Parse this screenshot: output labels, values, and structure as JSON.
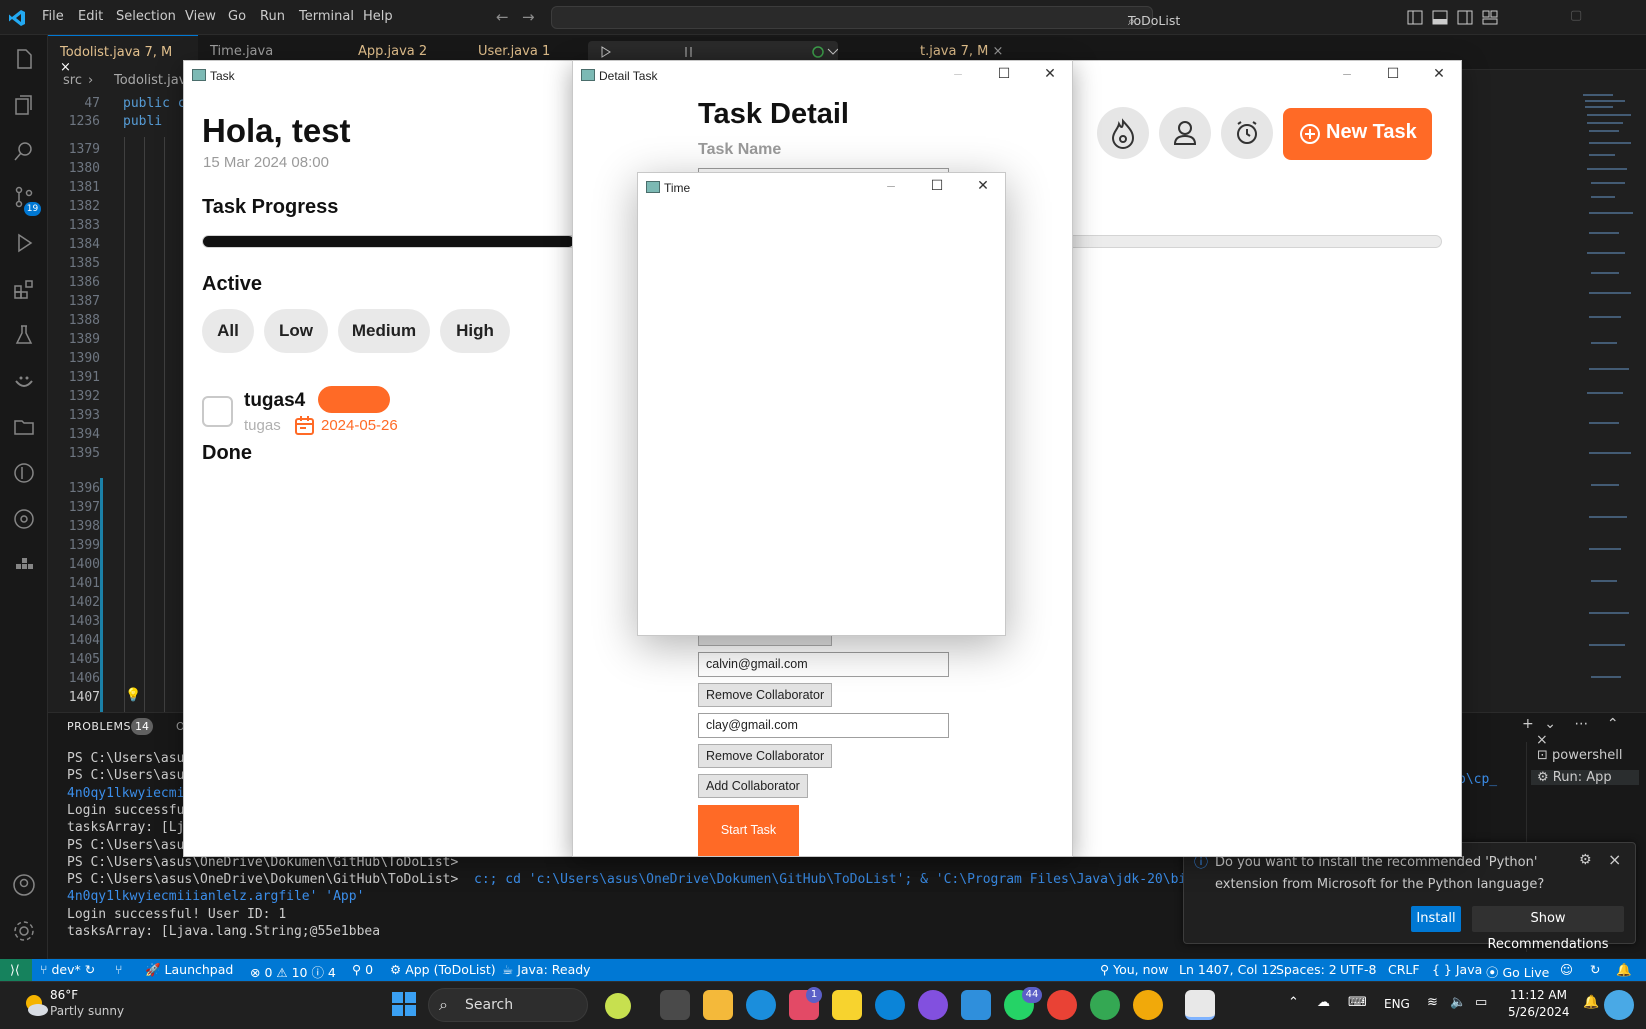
{
  "vscode": {
    "menu": [
      "File",
      "Edit",
      "Selection",
      "View",
      "Go",
      "Run",
      "Terminal",
      "Help"
    ],
    "search_label": "ToDoList",
    "tabs": [
      {
        "label": "Todolist.java",
        "badge": "7, M"
      },
      {
        "label": "Time.java",
        "badge": ""
      },
      {
        "label": "App.java",
        "badge": "2"
      },
      {
        "label": "User.java",
        "badge": "1"
      },
      {
        "label": "t.java",
        "badge": "7, M"
      }
    ],
    "breadcrumb": [
      "src",
      "Todolist.java"
    ],
    "code": {
      "sticky": [
        {
          "num": "47",
          "text": "public c"
        },
        {
          "num": "1236",
          "text": "  publi"
        }
      ],
      "line_numbers": [
        "1379",
        "1380",
        "1381",
        "1382",
        "1383",
        "1384",
        "1385",
        "1386",
        "1387",
        "1388",
        "1389",
        "1390",
        "1391",
        "1392",
        "1393",
        "1394",
        "1395",
        "1396",
        "1397",
        "1398",
        "1399",
        "1400",
        "1401",
        "1402",
        "1403",
        "1404",
        "1405",
        "1406",
        "1407"
      ]
    },
    "panel": {
      "title": "PROBLEMS",
      "problems_count": "14",
      "tab2_stub": "O",
      "terminal_lines": [
        {
          "ps": "PS C:\\Users\\asus",
          "rest": ""
        },
        {
          "ps": "PS C:\\Users\\asus",
          "rest": ""
        },
        {
          "ps": "",
          "rest": "4n0qy1lkwyiecmi"
        },
        {
          "ps": "",
          "rest": "Login successful"
        },
        {
          "ps": "",
          "rest": "tasksArray: [Lja"
        },
        {
          "ps": "PS C:\\Users\\asus",
          "rest": ""
        },
        {
          "ps": "PS C:\\Users\\asus\\OneDrive\\Dokumen\\GitHub\\ToDoList>",
          "rest": ""
        },
        {
          "ps": "PS C:\\Users\\asus\\OneDrive\\Dokumen\\GitHub\\ToDoList>",
          "rest": "  c:; cd 'c:\\Users\\asus\\OneDrive\\Dokumen\\GitHub\\ToDoList'; & 'C:\\Program Files\\Java\\jdk-20\\bin\\java.e"
        },
        {
          "ps": "",
          "rest": "4n0qy1lkwyiecmiiianlelz.argfile' 'App'"
        },
        {
          "ps": "",
          "rest": "Login successful! User ID: 1"
        },
        {
          "ps": "",
          "rest": "tasksArray: [Ljava.lang.String;@55e1bbea"
        }
      ],
      "right_stub": "p\\cp_",
      "terminals": [
        "powershell",
        "Run: App"
      ]
    },
    "notification": {
      "text": "Do you want to install the recommended 'Python' extension from Microsoft for the Python language?",
      "install": "Install",
      "show": "Show Recommendations"
    },
    "status": {
      "branch": "dev*",
      "launchpad": "Launchpad",
      "errors": "0",
      "warnings": "10",
      "infos": "4",
      "ports": "0",
      "app": "App (ToDoList)",
      "java": "Java: Ready",
      "blame": "You, now",
      "position": "Ln 1407, Col 12",
      "spaces": "Spaces: 2",
      "encoding": "UTF-8",
      "eol": "CRLF",
      "lang": "Java",
      "golive": "Go Live",
      "scm_badge": "19"
    }
  },
  "task_window": {
    "title": "Task",
    "greeting": "Hola, test",
    "datetime": "15 Mar 2024 08:00",
    "progress_label": "Task Progress",
    "progress_value": 0.3,
    "active_label": "Active",
    "filters": [
      "All",
      "Low",
      "Medium",
      "High"
    ],
    "task": {
      "name": "tugas4",
      "desc": "tugas",
      "date": "2024-05-26"
    },
    "done_label": "Done",
    "new_task": "New Task"
  },
  "detail_window": {
    "title": "Detail Task",
    "heading": "Task Detail",
    "task_name_label": "Task Name",
    "partial_button": "Remove Collaborator",
    "collaborators": [
      {
        "email": "calvin@gmail.com",
        "remove": "Remove Collaborator"
      },
      {
        "email": "clay@gmail.com",
        "remove": "Remove Collaborator"
      }
    ],
    "add_collaborator": "Add Collaborator",
    "start_task": "Start Task"
  },
  "time_window": {
    "title": "Time"
  },
  "taskbar": {
    "weather_temp": "86°F",
    "weather_desc": "Partly sunny",
    "search": "Search",
    "lang": "ENG",
    "time": "11:12 AM",
    "date": "5/26/2024",
    "badges": {
      "teams": "1",
      "whatsapp": "44"
    }
  },
  "colors": {
    "accent": "#ff6a26",
    "vscode_blue": "#0078d4"
  }
}
